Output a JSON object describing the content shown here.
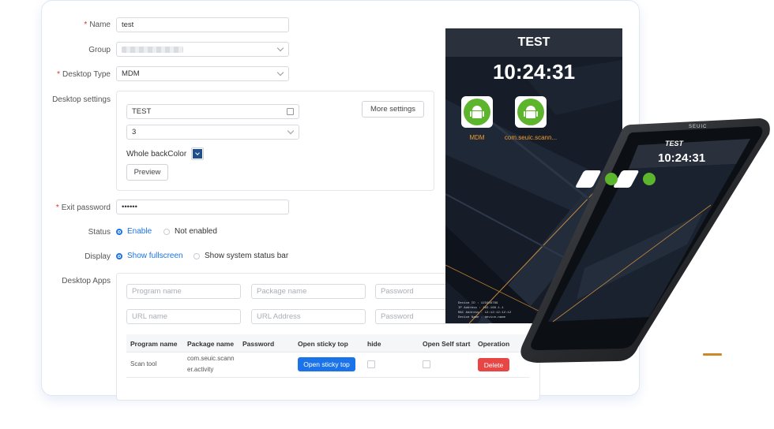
{
  "form": {
    "name_label": "Name",
    "name_value": "test",
    "group_label": "Group",
    "desktop_type_label": "Desktop Type",
    "desktop_type_value": "MDM",
    "desktop_settings_label": "Desktop settings",
    "settings": {
      "title_value": "TEST",
      "columns_value": "3",
      "whole_backcolor_label": "Whole backColor",
      "whole_backcolor": "#1f4f8c",
      "preview_button": "Preview",
      "more_settings_button": "More settings"
    },
    "exit_password_label": "Exit password",
    "exit_password_value": "••••••",
    "status_label": "Status",
    "status_options": [
      "Enable",
      "Not enabled"
    ],
    "display_label": "Display",
    "display_options": [
      "Show fullscreen",
      "Show system status bar"
    ],
    "desktop_apps_label": "Desktop Apps",
    "placeholders": {
      "program_name": "Program name",
      "package_name": "Package name",
      "password": "Password",
      "url_name": "URL name",
      "url_address": "URL Address"
    },
    "table": {
      "headers": [
        "Program name",
        "Package name",
        "Password",
        "Open sticky top",
        "hide",
        "Open Self start",
        "Operation"
      ],
      "rows": [
        {
          "program_name": "Scan tool",
          "package_line1": "com.seuic.scann",
          "package_line2": "er.activity",
          "sticky_button": "Open sticky top",
          "delete_button": "Delete"
        }
      ]
    }
  },
  "phone": {
    "title": "TEST",
    "time": "10:24:31",
    "apps": [
      "MDM",
      "com.seuic.scann..."
    ],
    "device_title": "TEST",
    "device_time": "10:24:31",
    "brand": "SEUIC",
    "device_info": [
      "Device ID : 123456789",
      "IP Address : 192.168.1.1",
      "MAC Address : 12:12:12:12:12",
      "Device Name : device-name"
    ]
  },
  "colors": {
    "primary": "#1a73e8",
    "danger": "#e84545",
    "required": "#e0302a",
    "app_label": "#f39c2b"
  }
}
